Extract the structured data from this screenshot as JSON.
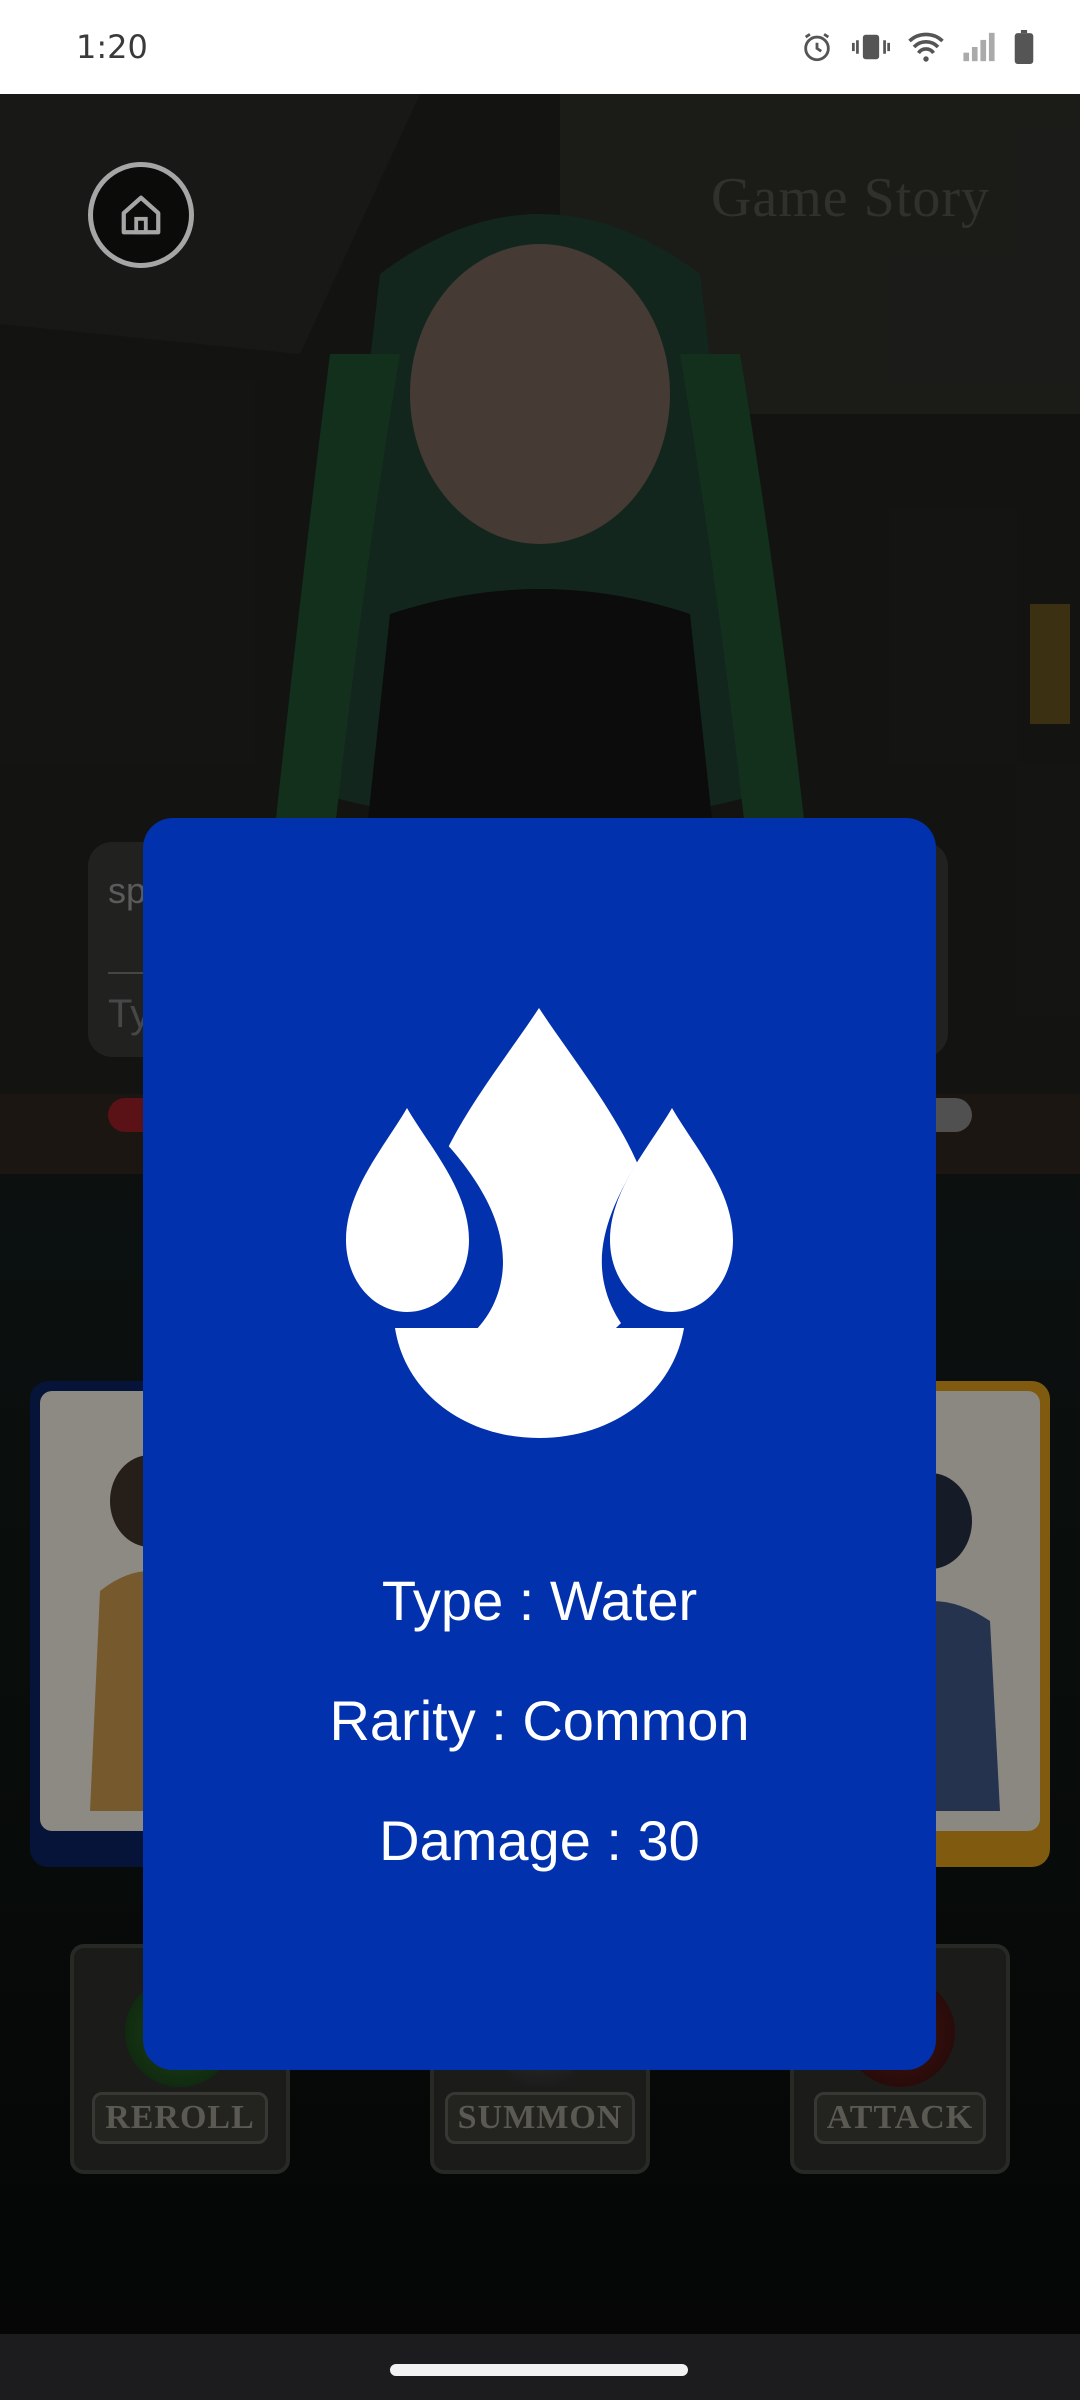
{
  "status_bar": {
    "time": "1:20",
    "icons": [
      "alarm-icon",
      "vibrate-icon",
      "wifi-icon",
      "signal-icon",
      "battery-icon"
    ]
  },
  "header": {
    "title": "Game Story",
    "home_icon": "home-icon"
  },
  "chat": {
    "partial_text": "sp",
    "input_placeholder_partial": "Ty"
  },
  "actions": {
    "reroll_label": "REROLL",
    "summon_label": "SUMMON",
    "attack_label": "ATTACK"
  },
  "card_modal": {
    "background_color": "#0231ad",
    "icon": "water-drops-icon",
    "type_text": "Type : Water",
    "rarity_text": "Rarity : Common",
    "damage_text": "Damage : 30"
  }
}
